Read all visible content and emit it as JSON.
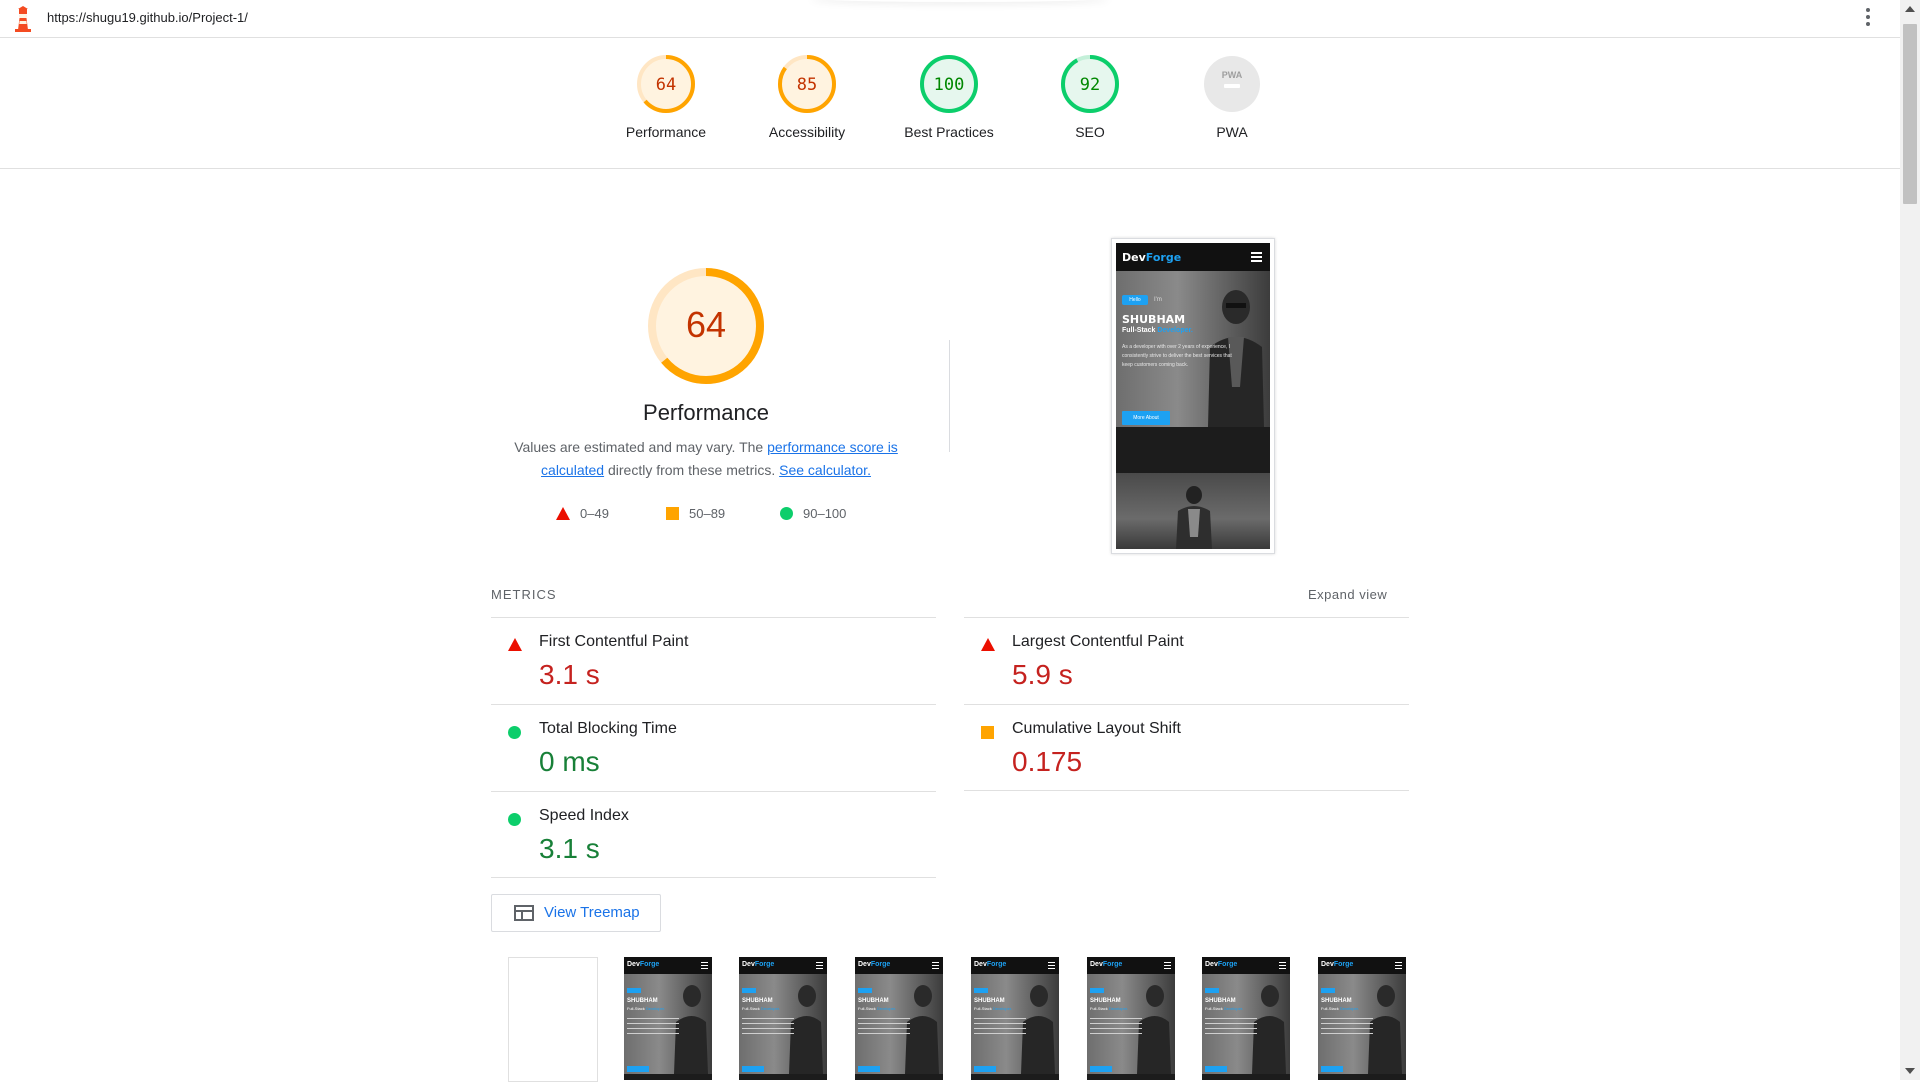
{
  "topbar": {
    "url": "https://shugu19.github.io/Project-1/"
  },
  "gauges": [
    {
      "label": "Performance",
      "score": "64",
      "value": 64,
      "status": "average"
    },
    {
      "label": "Accessibility",
      "score": "85",
      "value": 85,
      "status": "average"
    },
    {
      "label": "Best Practices",
      "score": "100",
      "value": 100,
      "status": "pass"
    },
    {
      "label": "SEO",
      "score": "92",
      "value": 92,
      "status": "pass"
    },
    {
      "label": "PWA",
      "score": "PWA",
      "value": 0,
      "status": "na"
    }
  ],
  "colors": {
    "fail": "#eb0f00",
    "average": "#ffa400",
    "pass": "#0cce6b",
    "average_text": "#c33300",
    "pass_text": "#008800",
    "average_bg": "#fff3e0",
    "pass_bg": "#e6f7ee",
    "na_bg": "#e8e8e8",
    "link": "#1a73e8"
  },
  "summary": {
    "score": "64",
    "score_value": 64,
    "title": "Performance",
    "desc_prefix": "Values are estimated and may vary. The ",
    "desc_link1": "performance score is calculated",
    "desc_mid": " directly from these metrics. ",
    "desc_link2": "See calculator."
  },
  "legend": [
    {
      "shape": "triangle",
      "range": "0–49"
    },
    {
      "shape": "square",
      "range": "50–89"
    },
    {
      "shape": "circle",
      "range": "90–100"
    }
  ],
  "preview": {
    "brand_a": "Dev",
    "brand_b": "Forge",
    "pill": "Hello",
    "pill2": "I'm",
    "name": "SHUBHAM",
    "role_a": "Full-Stack ",
    "role_b": "Developer.",
    "blurb": "As a developer with over 2 years of experience, I consistently strive to deliver the best services that keep customers coming back.",
    "button": "More About"
  },
  "metrics": {
    "heading": "METRICS",
    "expand": "Expand view",
    "items": [
      {
        "name": "First Contentful Paint",
        "value": "3.1 s",
        "rating": "fail"
      },
      {
        "name": "Largest Contentful Paint",
        "value": "5.9 s",
        "rating": "fail"
      },
      {
        "name": "Total Blocking Time",
        "value": "0 ms",
        "rating": "pass"
      },
      {
        "name": "Cumulative Layout Shift",
        "value": "0.175",
        "rating": "average"
      },
      {
        "name": "Speed Index",
        "value": "3.1 s",
        "rating": "pass"
      }
    ]
  },
  "treemap": {
    "label": "View Treemap"
  },
  "filmstrip": {
    "frames": 8,
    "blank_frames": 1
  }
}
